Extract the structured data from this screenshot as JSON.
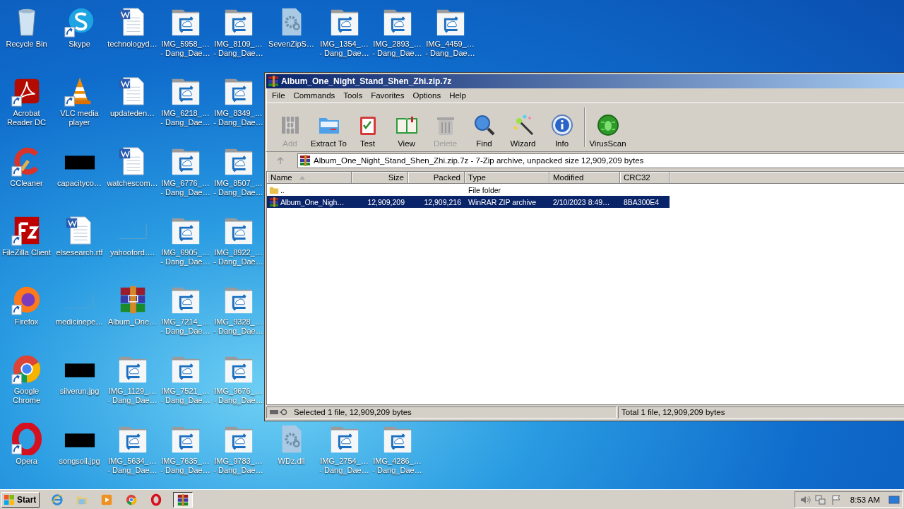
{
  "desktop": {
    "columns": [
      [
        {
          "label": "Recycle Bin",
          "kind": "recycle",
          "shortcut": false
        },
        {
          "label": "Acrobat\nReader DC",
          "kind": "pdf",
          "shortcut": true
        },
        {
          "label": "CCleaner",
          "kind": "ccleaner",
          "shortcut": true
        },
        {
          "label": "FileZilla Client",
          "kind": "filezilla",
          "shortcut": true
        },
        {
          "label": "Firefox",
          "kind": "firefox",
          "shortcut": true
        },
        {
          "label": "Google\nChrome",
          "kind": "chrome",
          "shortcut": true
        },
        {
          "label": "Opera",
          "kind": "opera",
          "shortcut": true
        }
      ],
      [
        {
          "label": "Skype",
          "kind": "skype",
          "shortcut": true
        },
        {
          "label": "VLC media\nplayer",
          "kind": "vlc",
          "shortcut": true
        },
        {
          "label": "capacityco…",
          "kind": "black",
          "shortcut": false
        },
        {
          "label": "elsesearch.rtf",
          "kind": "word",
          "shortcut": false
        },
        {
          "label": "medicinepe…",
          "kind": "blank",
          "shortcut": false
        },
        {
          "label": "silverun.jpg",
          "kind": "black",
          "shortcut": false
        },
        {
          "label": "songsoil.jpg",
          "kind": "black",
          "shortcut": false
        }
      ],
      [
        {
          "label": "technologyd…",
          "kind": "word",
          "shortcut": false
        },
        {
          "label": "updateden…",
          "kind": "word",
          "shortcut": false
        },
        {
          "label": "watchescom…",
          "kind": "word",
          "shortcut": false
        },
        {
          "label": "yahooford….",
          "kind": "blank",
          "shortcut": false
        },
        {
          "label": "Album_One…",
          "kind": "winrar",
          "shortcut": false
        },
        {
          "label": "IMG_1129_…\n- Dang_Dae…",
          "kind": "imgfolder",
          "shortcut": false
        },
        {
          "label": "IMG_5634_…\n- Dang_Dae…",
          "kind": "imgfolder",
          "shortcut": false
        }
      ],
      [
        {
          "label": "IMG_5958_…\n- Dang_Dae…",
          "kind": "imgfolder",
          "shortcut": false
        },
        {
          "label": "IMG_6218_…\n- Dang_Dae…",
          "kind": "imgfolder",
          "shortcut": false
        },
        {
          "label": "IMG_6776_…\n- Dang_Dae…",
          "kind": "imgfolder",
          "shortcut": false
        },
        {
          "label": "IMG_6905_…\n- Dang_Dae…",
          "kind": "imgfolder",
          "shortcut": false
        },
        {
          "label": "IMG_7214_…\n- Dang_Dae…",
          "kind": "imgfolder",
          "shortcut": false
        },
        {
          "label": "IMG_7521_…\n- Dang_Dae…",
          "kind": "imgfolder",
          "shortcut": false
        },
        {
          "label": "IMG_7635_…\n- Dang_Dae…",
          "kind": "imgfolder",
          "shortcut": false
        }
      ],
      [
        {
          "label": "IMG_8109_…\n- Dang_Dae…",
          "kind": "imgfolder",
          "shortcut": false
        },
        {
          "label": "IMG_8349_…\n- Dang_Dae…",
          "kind": "imgfolder",
          "shortcut": false
        },
        {
          "label": "IMG_8507_…\n- Dang_Dae…",
          "kind": "imgfolder",
          "shortcut": false
        },
        {
          "label": "IMG_8922_…\n- Dang_Dae…",
          "kind": "imgfolder",
          "shortcut": false
        },
        {
          "label": "IMG_9328_…\n- Dang_Dae…",
          "kind": "imgfolder",
          "shortcut": false
        },
        {
          "label": "IMG_9676_…\n- Dang_Dae…",
          "kind": "imgfolder",
          "shortcut": false
        },
        {
          "label": "IMG_9783_…\n- Dang_Dae…",
          "kind": "imgfolder",
          "shortcut": false
        }
      ]
    ],
    "top_row": [
      {
        "label": "SevenZipS…",
        "kind": "dll",
        "shortcut": false
      },
      {
        "label": "IMG_1354_…\n- Dang_Dae…",
        "kind": "imgfolder",
        "shortcut": false
      },
      {
        "label": "IMG_2893_…\n- Dang_Dae…",
        "kind": "imgfolder",
        "shortcut": false
      },
      {
        "label": "IMG_4459_…\n- Dang_Dae…",
        "kind": "imgfolder",
        "shortcut": false
      }
    ],
    "bottom_row": [
      {
        "label": "WDz.dll",
        "kind": "dll",
        "shortcut": false
      },
      {
        "label": "IMG_2754_…\n- Dang_Dae…",
        "kind": "imgfolder",
        "shortcut": false
      },
      {
        "label": "IMG_4286_…\n- Dang_Dae…",
        "kind": "imgfolder",
        "shortcut": false
      }
    ]
  },
  "window": {
    "title": "Album_One_Night_Stand_Shen_Zhi.zip.7z",
    "menu": [
      "File",
      "Commands",
      "Tools",
      "Favorites",
      "Options",
      "Help"
    ],
    "toolbar": [
      {
        "label": "Add",
        "kind": "add",
        "disabled": true
      },
      {
        "label": "Extract To",
        "kind": "extract",
        "disabled": false
      },
      {
        "label": "Test",
        "kind": "test",
        "disabled": false
      },
      {
        "label": "View",
        "kind": "view",
        "disabled": false
      },
      {
        "label": "Delete",
        "kind": "delete",
        "disabled": true
      },
      {
        "label": "Find",
        "kind": "find",
        "disabled": false
      },
      {
        "label": "Wizard",
        "kind": "wizard",
        "disabled": false
      },
      {
        "label": "Info",
        "kind": "info",
        "disabled": false
      },
      {
        "label": "VirusScan",
        "kind": "virus",
        "disabled": false
      }
    ],
    "address": "Album_One_Night_Stand_Shen_Zhi.zip.7z - 7-Zip archive, unpacked size 12,909,209 bytes",
    "columns": [
      {
        "label": "Name",
        "sorted": true
      },
      {
        "label": "Size",
        "sorted": false
      },
      {
        "label": "Packed",
        "sorted": false
      },
      {
        "label": "Type",
        "sorted": false
      },
      {
        "label": "Modified",
        "sorted": false
      },
      {
        "label": "CRC32",
        "sorted": false
      }
    ],
    "rows": [
      {
        "kind": "folder",
        "name": "..",
        "type": "File folder",
        "selected": false
      },
      {
        "kind": "archive",
        "name": "Album_One_Nigh…",
        "size": "12,909,209",
        "packed": "12,909,216",
        "type": "WinRAR ZIP archive",
        "modified": "2/10/2023 8:49…",
        "crc": "8BA300E4",
        "selected": true
      }
    ],
    "status_left": "Selected 1 file, 12,909,209 bytes",
    "status_right": "Total 1 file, 12,909,209 bytes"
  },
  "taskbar": {
    "start": "Start",
    "items": [
      {
        "kind": "ie",
        "selected": false
      },
      {
        "kind": "explorer",
        "selected": false
      },
      {
        "kind": "media",
        "selected": false
      },
      {
        "kind": "chrome",
        "selected": false
      },
      {
        "kind": "opera",
        "selected": false
      },
      {
        "kind": "winrar",
        "selected": true
      }
    ],
    "clock": "8:53 AM"
  }
}
